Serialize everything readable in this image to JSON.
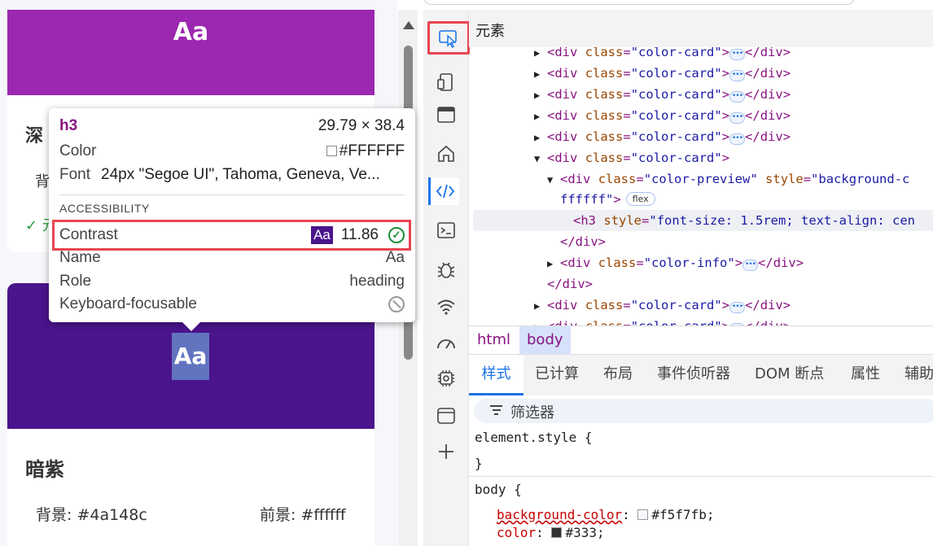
{
  "page": {
    "top_card": {
      "preview_text": "Aa",
      "title": "深",
      "bg_label": "背",
      "check": "✓ 元"
    },
    "card2": {
      "preview_text": "Aa",
      "title": "暗紫",
      "bg": "背景: #4a148c",
      "fg": "前景: #ffffff"
    }
  },
  "tooltip": {
    "tag": "h3",
    "size": "29.79 × 38.4",
    "color_label": "Color",
    "color_value": "#FFFFFF",
    "font_label": "Font",
    "font_value": "24px \"Segoe UI\", Tahoma, Geneva, Ve...",
    "section": "ACCESSIBILITY",
    "contrast_label": "Contrast",
    "contrast_chip": "Aa",
    "contrast_value": "11.86",
    "name_label": "Name",
    "name_value": "Aa",
    "role_label": "Role",
    "role_value": "heading",
    "focus_label": "Keyboard-focusable"
  },
  "devtools": {
    "panel_title": "元素",
    "dom": {
      "div": "div",
      "class": "class",
      "color_card": "\"color-card\"",
      "color_preview": "\"color-preview\"",
      "style_attr": "style",
      "style_val_start": "\"background-c",
      "style_val_cont": "ffffff\"",
      "flex": "flex",
      "h3": "h3",
      "h3_style": "\"font-size: 1.5rem; text-align: cen",
      "color_info": "\"color-info\""
    },
    "breadcrumb": [
      "html",
      "body"
    ],
    "tabs": [
      "样式",
      "已计算",
      "布局",
      "事件侦听器",
      "DOM 断点",
      "属性",
      "辅助"
    ],
    "filter_label": "筛选器",
    "rules": {
      "element_style": "element.style {",
      "close": "}",
      "body_selector": "body {",
      "bg_prop": "background-color",
      "bg_value": "#f5f7fb;",
      "color_prop": "color",
      "color_value": "#333;"
    }
  },
  "colors": {
    "purple": "#9c27b0",
    "deep_purple": "#4a148c",
    "accent_blue": "#1a73e8",
    "highlight_red": "#e8454f"
  }
}
